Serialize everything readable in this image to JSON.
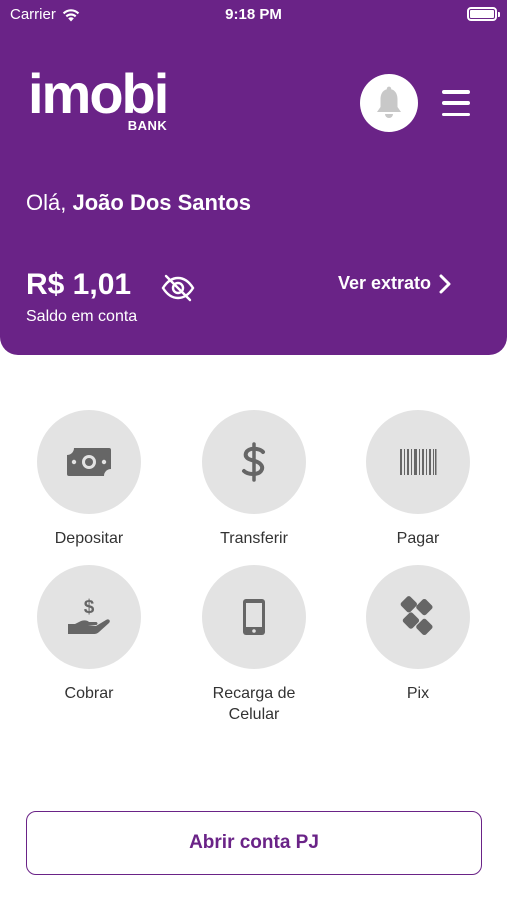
{
  "status_bar": {
    "carrier": "Carrier",
    "time": "9:18 PM"
  },
  "brand": {
    "logo_text": "imobi",
    "logo_sub": "BANK",
    "color": "#6a2387"
  },
  "greeting": {
    "prefix": "Olá,",
    "name": "João Dos Santos"
  },
  "balance": {
    "amount": "R$ 1,01",
    "label": "Saldo em conta"
  },
  "statement_link": {
    "label": "Ver extrato"
  },
  "actions": [
    {
      "label": "Depositar",
      "icon": "money-bill-icon"
    },
    {
      "label": "Transferir",
      "icon": "dollar-sign-icon"
    },
    {
      "label": "Pagar",
      "icon": "barcode-icon"
    },
    {
      "label": "Cobrar",
      "icon": "hand-holding-dollar-icon"
    },
    {
      "label": "Recarga de\nCelular",
      "icon": "mobile-phone-icon"
    },
    {
      "label": "Pix",
      "icon": "pix-icon"
    }
  ],
  "open_pj_button": {
    "label": "Abrir conta PJ"
  }
}
